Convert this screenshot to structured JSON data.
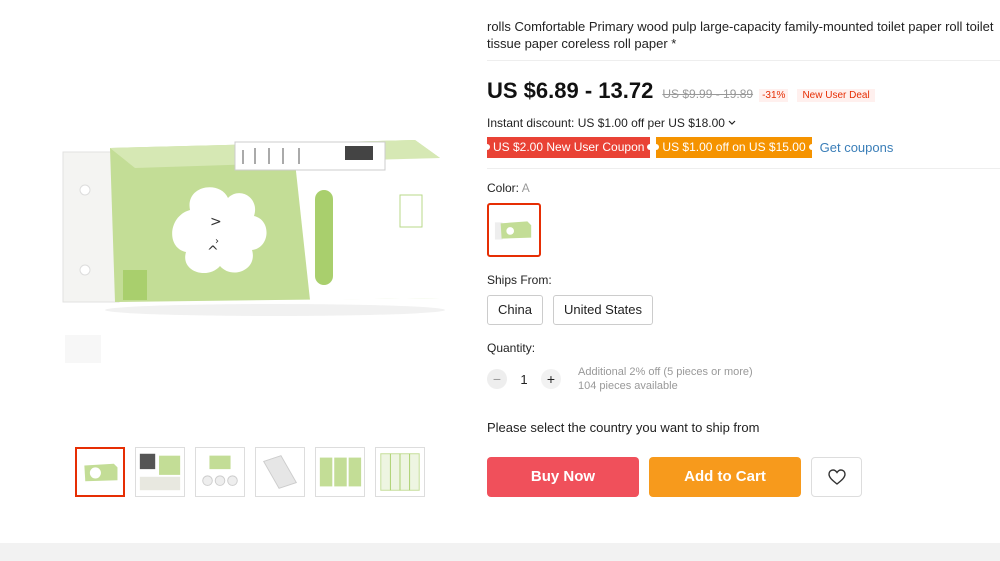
{
  "product": {
    "title": "rolls Comfortable Primary wood pulp large-capacity family-mounted toilet paper roll toilet tissue paper coreless roll paper *"
  },
  "pricing": {
    "price": "US $6.89 - 13.72",
    "original_price": "US $9.99 - 19.89",
    "discount_percent": "-31%",
    "deal_badge": "New User Deal",
    "instant_discount": "Instant discount: US $1.00 off per US $18.00",
    "instant_discount_chevron": "chevron-down-icon"
  },
  "coupons": {
    "items": [
      {
        "label": "US $2.00 New User Coupon",
        "color": "#e94235"
      },
      {
        "label": "US $1.00 off on US $15.00",
        "color": "#f59300"
      }
    ],
    "get_coupons_label": "Get coupons"
  },
  "color": {
    "label": "Color:",
    "selected": "A"
  },
  "shipping": {
    "label": "Ships From:",
    "options": [
      "China",
      "United States"
    ]
  },
  "quantity": {
    "label": "Quantity:",
    "value": "1",
    "minus": "−",
    "plus": "+",
    "note_discount": "Additional 2% off (5 pieces or more)",
    "note_available": "104 pieces available"
  },
  "select_message": "Please select the country you want to ship from",
  "actions": {
    "buy_now": "Buy Now",
    "add_to_cart": "Add to Cart",
    "wishlist_icon": "heart-icon"
  },
  "colors": {
    "accent_red": "#e62e04",
    "buy_now": "#f0505b",
    "add_to_cart": "#f79a1c",
    "link": "#3a7eb8",
    "package_green": "#b9d98a"
  }
}
